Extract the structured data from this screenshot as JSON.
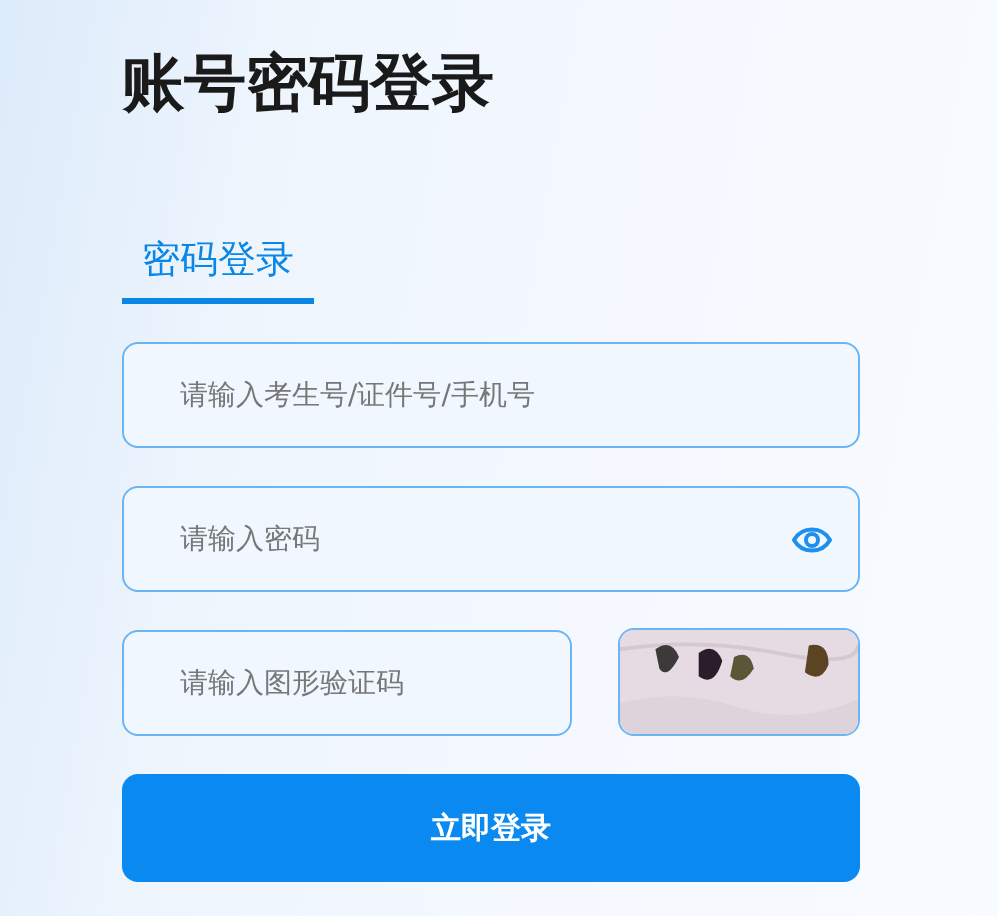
{
  "title": "账号密码登录",
  "tabs": [
    {
      "label": "密码登录",
      "selected": true
    }
  ],
  "fields": [
    {
      "kind": "account",
      "placeholder": "请输入考生号/证件号/手机号"
    },
    {
      "kind": "password",
      "placeholder": "请输入密码"
    },
    {
      "kind": "captcha",
      "placeholder": "请输入图形验证码"
    }
  ],
  "submit": "立即登录"
}
